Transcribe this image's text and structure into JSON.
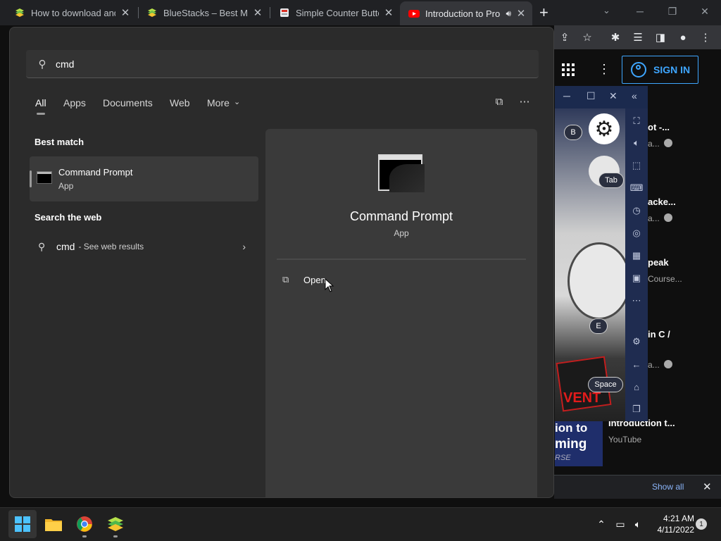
{
  "browser": {
    "tabs": [
      {
        "title": "How to download and",
        "favicon": "bluestacks-icon"
      },
      {
        "title": "BlueStacks – Best Mobi",
        "favicon": "bluestacks-icon"
      },
      {
        "title": "Simple Counter Button",
        "favicon": "page-icon"
      },
      {
        "title": "Introduction to Pro",
        "favicon": "youtube-icon"
      }
    ],
    "new_tab_symbol": "+"
  },
  "youtube": {
    "sign_in_label": "SIGN IN",
    "sidebar_fragments": [
      {
        "title": "ot -...",
        "sub": "a..."
      },
      {
        "title": "acke...",
        "sub": "a..."
      },
      {
        "title": "peak",
        "sub": "Course..."
      },
      {
        "title": "in C /",
        "sub": "a..."
      }
    ],
    "promo": {
      "line1": "ion to",
      "line2": "ming",
      "line3": "RSE"
    },
    "bottom_video_title": "Introduction t...",
    "bottom_video_channel": "YouTube"
  },
  "bluestacks": {
    "keys": {
      "b": "B",
      "tab": "Tab",
      "e": "E",
      "space": "Space"
    }
  },
  "download_bar": {
    "show_all": "Show all"
  },
  "search": {
    "query": "cmd",
    "filters": [
      "All",
      "Apps",
      "Documents",
      "Web",
      "More"
    ],
    "active_filter": "All",
    "best_match_heading": "Best match",
    "best_match": {
      "name": "Command Prompt",
      "kind": "App"
    },
    "web_heading": "Search the web",
    "web_result": {
      "query": "cmd",
      "suffix": "- See web results"
    },
    "detail": {
      "name": "Command Prompt",
      "kind": "App",
      "action_open": "Open"
    }
  },
  "taskbar": {
    "time": "4:21 AM",
    "date": "4/11/2022",
    "notification_count": "1"
  },
  "colors": {
    "accent_blue": "#3ea6ff",
    "panel_bg": "#2b2b2b",
    "taskbar_bg": "#202020"
  }
}
